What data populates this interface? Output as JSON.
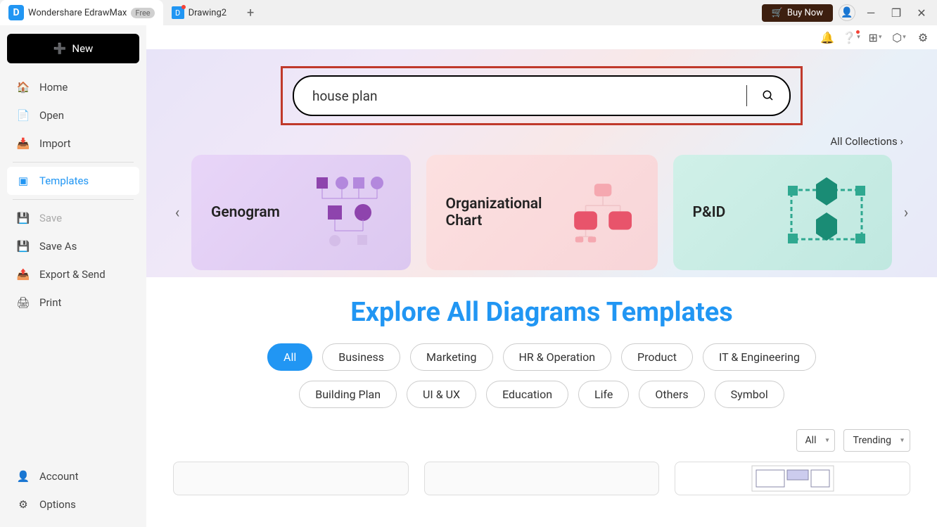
{
  "titlebar": {
    "app_name": "Wondershare EdrawMax",
    "badge": "Free",
    "doc_tab": "Drawing2",
    "buy_now": "Buy Now"
  },
  "sidebar": {
    "new_button": "New",
    "items": [
      {
        "label": "Home"
      },
      {
        "label": "Open"
      },
      {
        "label": "Import"
      }
    ],
    "templates": "Templates",
    "file_items": [
      {
        "label": "Save"
      },
      {
        "label": "Save As"
      },
      {
        "label": "Export & Send"
      },
      {
        "label": "Print"
      }
    ],
    "footer": [
      {
        "label": "Account"
      },
      {
        "label": "Options"
      }
    ]
  },
  "main": {
    "search_value": "house plan",
    "all_collections": "All Collections",
    "cards": [
      {
        "title": "Genogram"
      },
      {
        "title": "Organizational Chart"
      },
      {
        "title": "P&ID"
      }
    ],
    "explore_prefix": "Explore",
    "explore_highlight": "All Diagrams Templates",
    "categories_row1": [
      "All",
      "Business",
      "Marketing",
      "HR & Operation",
      "Product",
      "IT & Engineering",
      "Building Plan"
    ],
    "categories_row2": [
      "UI & UX",
      "Education",
      "Life",
      "Others",
      "Symbol"
    ],
    "filter1": "All",
    "filter2": "Trending"
  }
}
